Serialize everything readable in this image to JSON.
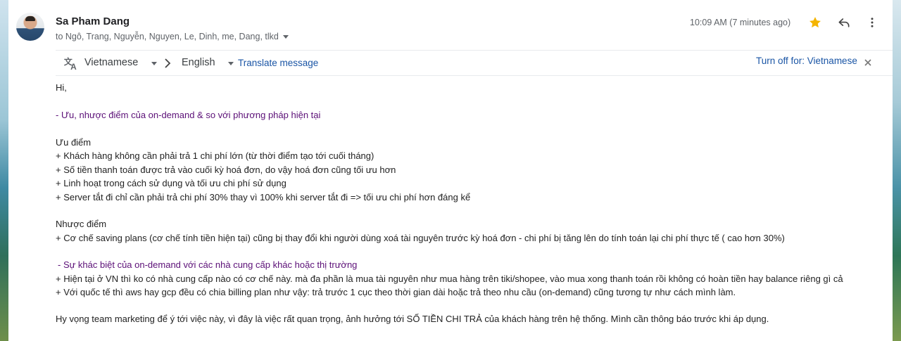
{
  "sender": {
    "name": "Sa Pham Dang",
    "recipients": "to Ngô, Trang, Nguyễn, Nguyen, Le, Dinh, me, Dang, tlkd"
  },
  "header": {
    "timestamp": "10:09 AM (7 minutes ago)",
    "star_color": "#f4b400"
  },
  "translate_bar": {
    "from_language": "Vietnamese",
    "to_language": "English",
    "translate_link": "Translate message",
    "turn_off_link": "Turn off for: Vietnamese"
  },
  "body": {
    "greeting": "Hi,",
    "section1_heading": "- Ưu, nhược điểm của on-demand & so với phương pháp hiện tại",
    "pros_title": "Ưu điểm",
    "pros": [
      "+ Khách hàng không cần phải trả 1 chi phí lớn (từ thời điểm tạo tới cuối tháng)",
      "+ Số tiền thanh toán được trả vào cuối kỳ hoá đơn, do vậy hoá đơn cũng tối ưu hơn",
      "+ Linh hoạt trong cách sử dụng và tối ưu chi phí sử dụng",
      "+ Server tắt đi chỉ cần phải trả chi phí 30% thay vì 100% khi server tắt đi => tối ưu chi phí hơn đáng kể"
    ],
    "cons_title": "Nhược điểm",
    "cons": [
      "+ Cơ chế saving plans (cơ chế tính tiền hiện tại) cũng bị thay đổi khi người dùng xoá tài nguyên trước kỳ hoá đơn - chi phí bị tăng lên do tính toán lại chi phí thực tế ( cao hơn 30%)"
    ],
    "section2_heading": "- Sự khác biệt của on-demand với các nhà cung cấp khác hoặc thị trường",
    "differences": [
      "+ Hiện tại ở VN thì ko có nhà cung cấp nào có cơ chế này. mà đa phần là mua tài nguyên như mua hàng trên tiki/shopee, vào mua xong thanh toán rồi không có hoàn tiền hay balance riêng gì cả",
      "+ Với quốc tế thì aws hay gcp đều có chia billing plan như vậy: trả trước 1 cục theo thời gian dài hoặc trả theo nhu cầu (on-demand) cũng tương tự như cách mình làm."
    ],
    "closing": "Hy vọng team marketing để ý tới việc này, vì đây là việc rất quan trọng, ảnh hưởng tới SỐ TIỀN CHI TRẢ của khách hàng trên hệ thống. Mình cần thông báo trước khi áp dụng."
  }
}
